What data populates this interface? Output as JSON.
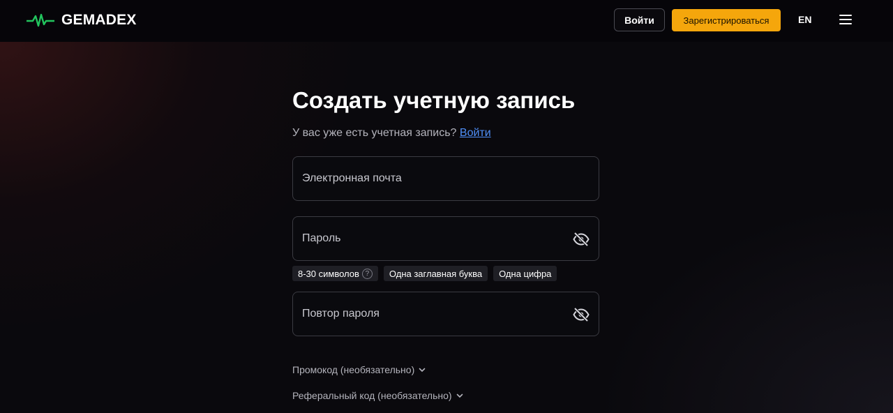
{
  "header": {
    "logo_text": "GEMADEX",
    "login_label": "Войти",
    "register_label": "Зарегистрироваться",
    "lang_label": "EN"
  },
  "form": {
    "title": "Создать учетную запись",
    "subtitle_text": "У вас уже есть учетная запись?",
    "subtitle_link": "Войти",
    "email_placeholder": "Электронная почта",
    "password_placeholder": "Пароль",
    "password_hints": [
      "8-30 символов",
      "Одна заглавная буква",
      "Одна цифра"
    ],
    "repeat_password_placeholder": "Повтор пароля",
    "promo_label": "Промокод (необязательно)",
    "referral_label": "Реферальный код (необязательно)"
  },
  "colors": {
    "accent": "#f5a60c",
    "link": "#4f8ff7",
    "logo_pulse": "#22c55e"
  }
}
